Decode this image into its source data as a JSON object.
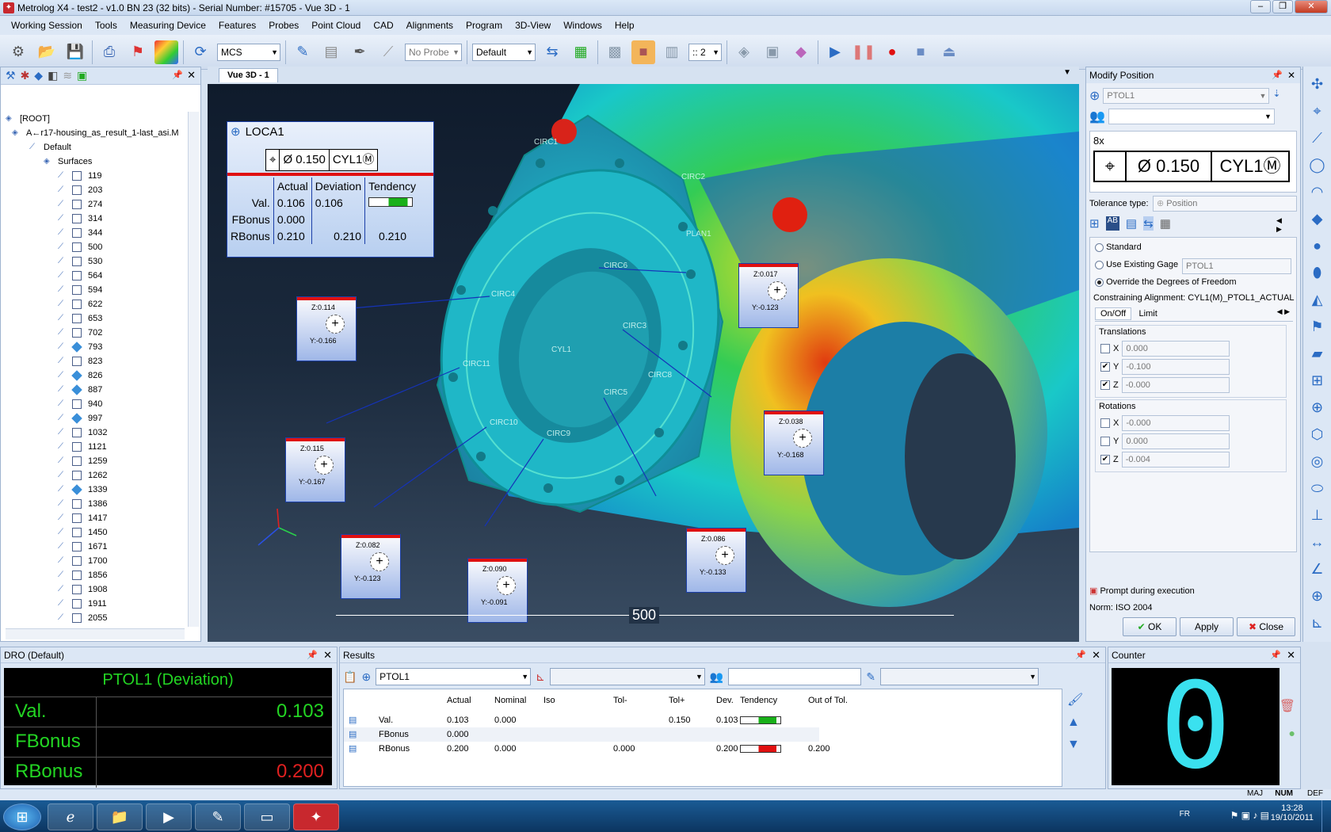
{
  "window": {
    "title": "Metrolog X4 - test2 - v1.0 BN 23 (32 bits) - Serial Number: #15705 - Vue 3D - 1"
  },
  "menu": [
    "Working Session",
    "Tools",
    "Measuring Device",
    "Features",
    "Probes",
    "Point Cloud",
    "CAD",
    "Alignments",
    "Program",
    "3D-View",
    "Windows",
    "Help"
  ],
  "toolbar": {
    "coord_system": "MCS",
    "probe": "No Probe",
    "view": "Default",
    "count": ":: 2"
  },
  "tree": {
    "root": "[ROOT]",
    "model": "A←r17-housing_as_result_1-last_asi.M",
    "default": "Default",
    "surfaces": "Surfaces",
    "items": [
      {
        "id": "119",
        "shape": "box"
      },
      {
        "id": "203",
        "shape": "box"
      },
      {
        "id": "274",
        "shape": "box"
      },
      {
        "id": "314",
        "shape": "box"
      },
      {
        "id": "344",
        "shape": "box"
      },
      {
        "id": "500",
        "shape": "box"
      },
      {
        "id": "530",
        "shape": "box"
      },
      {
        "id": "564",
        "shape": "box"
      },
      {
        "id": "594",
        "shape": "box"
      },
      {
        "id": "622",
        "shape": "box"
      },
      {
        "id": "653",
        "shape": "box"
      },
      {
        "id": "702",
        "shape": "box"
      },
      {
        "id": "793",
        "shape": "diamond"
      },
      {
        "id": "823",
        "shape": "box"
      },
      {
        "id": "826",
        "shape": "diamond"
      },
      {
        "id": "887",
        "shape": "diamond"
      },
      {
        "id": "940",
        "shape": "box"
      },
      {
        "id": "997",
        "shape": "diamond"
      },
      {
        "id": "1032",
        "shape": "box"
      },
      {
        "id": "1121",
        "shape": "box"
      },
      {
        "id": "1259",
        "shape": "box"
      },
      {
        "id": "1262",
        "shape": "box"
      },
      {
        "id": "1339",
        "shape": "diamond"
      },
      {
        "id": "1386",
        "shape": "box"
      },
      {
        "id": "1417",
        "shape": "box"
      },
      {
        "id": "1450",
        "shape": "box"
      },
      {
        "id": "1671",
        "shape": "box"
      },
      {
        "id": "1700",
        "shape": "box"
      },
      {
        "id": "1856",
        "shape": "box"
      },
      {
        "id": "1908",
        "shape": "box"
      },
      {
        "id": "1911",
        "shape": "box"
      },
      {
        "id": "2055",
        "shape": "box"
      }
    ]
  },
  "viewport": {
    "tab": "Vue 3D - 1",
    "loca": {
      "title": "LOCA1",
      "fcf": {
        "symbol": "⌖",
        "tol": "Ø 0.150",
        "datum": "CYL1Ⓜ"
      },
      "headers": [
        "Actual",
        "Deviation",
        "Tendency"
      ],
      "rows": [
        {
          "label": "Val.",
          "actual": "0.106",
          "deviation": "0.106",
          "tendency": ""
        },
        {
          "label": "FBonus",
          "actual": "0.000",
          "deviation": "",
          "tendency": ""
        },
        {
          "label": "RBonus",
          "actual": "0.210",
          "deviation": "0.210",
          "tendency": "0.210"
        }
      ]
    },
    "labels": [
      {
        "z": "Z:0.114",
        "y": "Y:-0.166"
      },
      {
        "z": "Z:0.017",
        "y": "Y:-0.123"
      },
      {
        "z": "Z:0.038",
        "y": "Y:-0.168"
      },
      {
        "z": "Z:0.115",
        "y": "Y:-0.167"
      },
      {
        "z": "Z:0.082",
        "y": "Y:-0.123"
      },
      {
        "z": "Z:0.090",
        "y": "Y:-0.091"
      },
      {
        "z": "Z:0.086",
        "y": "Y:-0.133"
      }
    ],
    "feature_tags": [
      "CIRC1",
      "CIRC2",
      "PLAN1",
      "CIRC6",
      "CIRC4",
      "CYL1",
      "CIRC3",
      "CIRC11",
      "CIRC9",
      "CIRC5",
      "CIRC8",
      "CIRC10"
    ],
    "scale": "500"
  },
  "modify": {
    "title": "Modify Position",
    "feature": "PTOL1",
    "multiplier": "8x",
    "fcf_symbol": "⌖",
    "fcf_tol": "Ø 0.150",
    "fcf_datum": "CYL1Ⓜ",
    "tol_type_label": "Tolerance type:",
    "tol_type": "Position",
    "opt_standard": "Standard",
    "opt_gage": "Use Existing Gage",
    "gage_value": "PTOL1",
    "opt_override": "Override the Degrees of Freedom",
    "constraining": "Constraining Alignment: CYL1(M)_PTOL1_ACTUAL",
    "tab_onoff": "On/Off",
    "tab_limit": "Limit",
    "translations": "Translations",
    "rotations": "Rotations",
    "t": [
      {
        "axis": "X",
        "checked": false,
        "value": "0.000"
      },
      {
        "axis": "Y",
        "checked": true,
        "value": "-0.100"
      },
      {
        "axis": "Z",
        "checked": true,
        "value": "-0.000"
      }
    ],
    "r": [
      {
        "axis": "X",
        "checked": false,
        "value": "-0.000"
      },
      {
        "axis": "Y",
        "checked": false,
        "value": "0.000"
      },
      {
        "axis": "Z",
        "checked": true,
        "value": "-0.004"
      }
    ],
    "prompt": "Prompt during execution",
    "norm": "Norm: ISO 2004",
    "ok": "OK",
    "apply": "Apply",
    "close": "Close"
  },
  "dro": {
    "title": "DRO (Default)",
    "heading": "PTOL1 (Deviation)",
    "rows": [
      {
        "label": "Val.",
        "value": "0.103",
        "color": "#23d523"
      },
      {
        "label": "FBonus",
        "value": "",
        "color": "#23d523"
      },
      {
        "label": "RBonus",
        "value": "0.200",
        "color": "#e02020"
      }
    ]
  },
  "results": {
    "title": "Results",
    "feature": "PTOL1",
    "headers": [
      "Actual",
      "Nominal",
      "Iso",
      "Tol-",
      "Tol+",
      "Dev.",
      "Tendency",
      "Out of Tol."
    ],
    "rows": [
      {
        "label": "Val.",
        "actual": "0.103",
        "nominal": "0.000",
        "iso": "",
        "tolm": "",
        "tolp": "0.150",
        "dev": "0.103",
        "out": ""
      },
      {
        "label": "FBonus",
        "actual": "0.000",
        "nominal": "",
        "iso": "",
        "tolm": "",
        "tolp": "",
        "dev": "",
        "out": ""
      },
      {
        "label": "RBonus",
        "actual": "0.200",
        "nominal": "0.000",
        "iso": "",
        "tolm": "0.000",
        "tolp": "",
        "dev": "0.200",
        "out": "0.200"
      }
    ]
  },
  "counter": {
    "title": "Counter",
    "value": "0"
  },
  "status": {
    "maj": "MAJ",
    "num": "NUM",
    "def": "DEF"
  },
  "taskbar": {
    "lang": "FR",
    "time": "13:28",
    "date": "19/10/2011"
  }
}
